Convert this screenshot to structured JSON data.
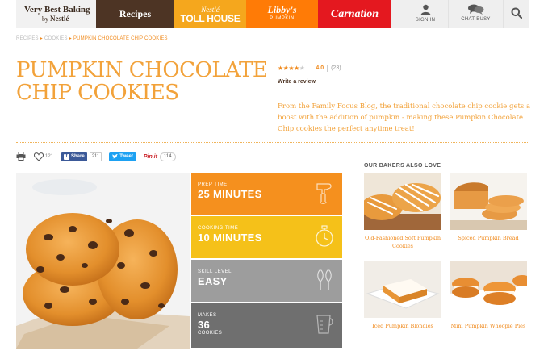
{
  "nav": {
    "logo_line1": "Very Best Baking",
    "logo_by": "by",
    "logo_brand": "Nestlé",
    "recipes": "Recipes",
    "tollhouse_brand": "Nestlé",
    "tollhouse_name": "TOLL HOUSE",
    "libbys_name": "Libby's",
    "libbys_sub": "PUMPKIN",
    "carnation": "Carnation",
    "sign_in": "SIGN IN",
    "chat": "CHAT BUSY"
  },
  "breadcrumb": [
    "RECIPES",
    "COOKIES",
    "PUMPKIN CHOCOLATE CHIP COOKIES"
  ],
  "recipe": {
    "title": "PUMPKIN CHOCOLATE CHIP COOKIES",
    "rating": 4.0,
    "rating_text": "4.0",
    "rating_count": "(23)",
    "write_review": "Write a review",
    "description": "From the Family Focus Blog, the traditional chocolate chip cookie gets a boost with the addition of pumpkin - making these Pumpkin Chocolate Chip cookies the perfect anytime treat!"
  },
  "social": {
    "favorites": "121",
    "fb_label": "Share",
    "fb_count": "211",
    "tweet_label": "Tweet",
    "pin_label": "Pin it",
    "pin_count": "114"
  },
  "stats": [
    {
      "label": "PREP TIME",
      "value": "25 MINUTES",
      "sub": "",
      "icon": "mixer-icon",
      "color": "#f5901e"
    },
    {
      "label": "COOKING TIME",
      "value": "10 MINUTES",
      "sub": "",
      "icon": "stopwatch-icon",
      "color": "#f5c119"
    },
    {
      "label": "SKILL LEVEL",
      "value": "EASY",
      "sub": "",
      "icon": "whisk-icon",
      "color": "#9d9d9d"
    },
    {
      "label": "MAKES",
      "value": "36",
      "sub": "COOKIES",
      "icon": "measuring-cup-icon",
      "color": "#6f6f6f"
    }
  ],
  "also_love": {
    "title": "OUR BAKERS ALSO LOVE",
    "items": [
      {
        "caption": "Old-Fashioned Soft Pumpkin Cookies"
      },
      {
        "caption": "Spiced Pumpkin Bread"
      },
      {
        "caption": "Iced Pumpkin Blondies"
      },
      {
        "caption": "Mini Pumpkin Whoopie Pies"
      }
    ]
  },
  "colors": {
    "accent_orange": "#f2a23a",
    "brand_brown": "#4d3424",
    "tollhouse": "#f5a71d",
    "libbys": "#ff7b06",
    "carnation": "#e4181f"
  }
}
